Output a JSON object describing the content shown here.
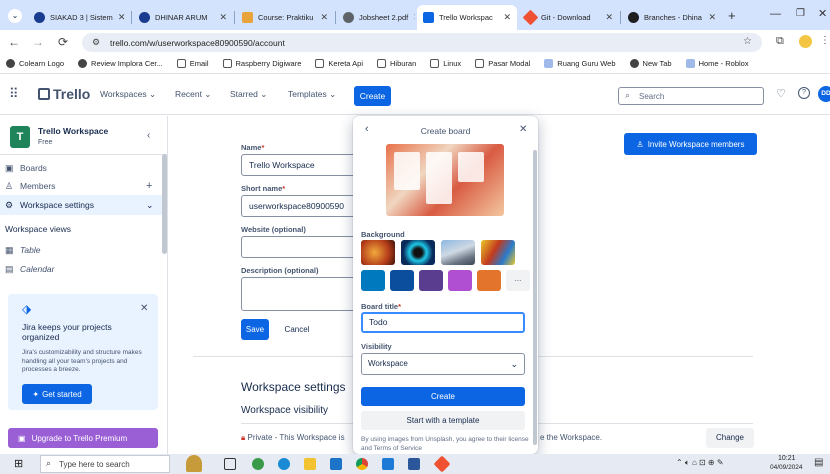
{
  "browser": {
    "tabs": [
      {
        "title": "SIAKAD 3 | Sistem",
        "color": "#1a3c8f"
      },
      {
        "title": "DHINAR ARUM",
        "color": "#1a3c8f"
      },
      {
        "title": "Course: Praktiku",
        "color": "#e8a33a"
      },
      {
        "title": "Jobsheet 2.pdf",
        "color": "#5f6368"
      },
      {
        "title": "Trello Workspac",
        "color": "#0c66e4",
        "active": true
      },
      {
        "title": "Git - Download",
        "color": "#f05133"
      },
      {
        "title": "Branches - Dhina",
        "color": "#1f1f1f"
      }
    ],
    "new_tab": "+",
    "url": "trello.com/w/userworkspace80900590/account",
    "bookmarks": [
      "Colearn Logo",
      "Review Implora Cer...",
      "Email",
      "Raspberry Digiware",
      "Kereta Api",
      "Hiburan",
      "Linux",
      "Pasar Modal",
      "Ruang Guru Web",
      "New Tab",
      "Home - Roblox"
    ]
  },
  "header": {
    "logo": "Trello",
    "menus": [
      "Workspaces",
      "Recent",
      "Starred",
      "Templates"
    ],
    "create": "Create",
    "search_placeholder": "Search",
    "avatar": "DD"
  },
  "sidebar": {
    "workspace_initial": "T",
    "workspace_name": "Trello Workspace",
    "workspace_plan": "Free",
    "items": [
      {
        "label": "Boards",
        "icon": "board-icon"
      },
      {
        "label": "Members",
        "icon": "person-icon"
      },
      {
        "label": "Workspace settings",
        "icon": "gear-icon"
      }
    ],
    "views_title": "Workspace views",
    "views": [
      {
        "label": "Table",
        "icon": "table-icon"
      },
      {
        "label": "Calendar",
        "icon": "calendar-icon"
      }
    ],
    "jira": {
      "title": "Jira keeps your projects organized",
      "body": "Jira's customizability and structure makes handling all your team's projects and processes a breeze.",
      "button": "Get started"
    },
    "upgrade": "Upgrade to Trello Premium"
  },
  "form": {
    "name_label": "Name",
    "name_value": "Trello Workspace",
    "short_label": "Short name",
    "short_value": "userworkspace80900590",
    "website_label": "Website (optional)",
    "desc_label": "Description (optional)",
    "save": "Save",
    "cancel": "Cancel",
    "invite": "Invite Workspace members",
    "settings_title": "Workspace settings",
    "visibility_title": "Workspace visibility",
    "private_text": "Private - This Workspace is",
    "private_tail": "e the Workspace.",
    "change": "Change"
  },
  "popover": {
    "title": "Create board",
    "background_label": "Background",
    "more": "...",
    "board_title_label": "Board title",
    "board_title_value": "Todo",
    "visibility_label": "Visibility",
    "visibility_value": "Workspace",
    "create": "Create",
    "template": "Start with a template",
    "footer": "By using images from Unsplash, you agree to their license and Terms of Service",
    "swatches": [
      "#0079bf",
      "#0b4e9e",
      "#5a3d8f",
      "#b04fd1",
      "#e2752b"
    ]
  },
  "taskbar": {
    "search_placeholder": "Type here to search",
    "time": "10:21",
    "date": "04/09/2024"
  }
}
